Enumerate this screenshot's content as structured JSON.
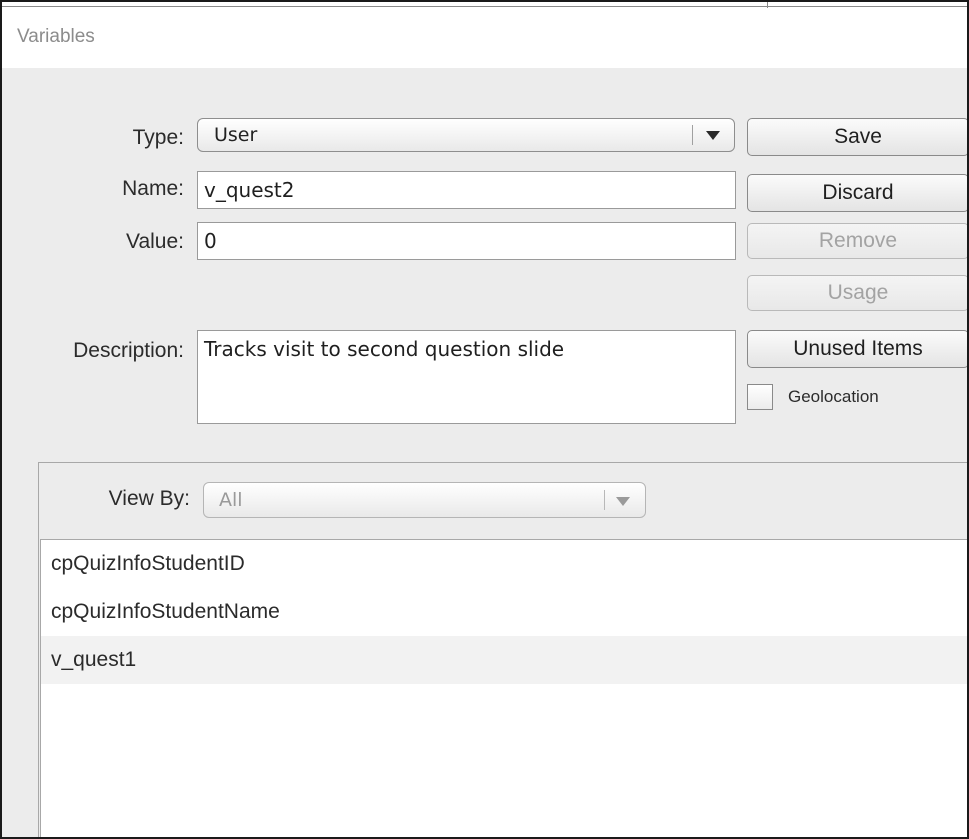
{
  "window": {
    "title": "Variables"
  },
  "form": {
    "type_label": "Type:",
    "type_value": "User",
    "name_label": "Name:",
    "name_value": "v_quest2",
    "value_label": "Value:",
    "value_value": "0",
    "description_label": "Description:",
    "description_value": "Tracks visit to second question slide"
  },
  "buttons": {
    "save": "Save",
    "discard": "Discard",
    "remove": "Remove",
    "usage": "Usage",
    "unused_items": "Unused Items"
  },
  "geolocation": {
    "label": "Geolocation",
    "checked": false
  },
  "view_by": {
    "label": "View By:",
    "value": "All"
  },
  "variables": {
    "items": [
      {
        "name": "cpQuizInfoStudentID"
      },
      {
        "name": "cpQuizInfoStudentName"
      },
      {
        "name": "v_quest1"
      }
    ]
  },
  "icons": {
    "type_dropdown": "chevron-down-icon",
    "view_by_dropdown": "chevron-down-icon"
  }
}
